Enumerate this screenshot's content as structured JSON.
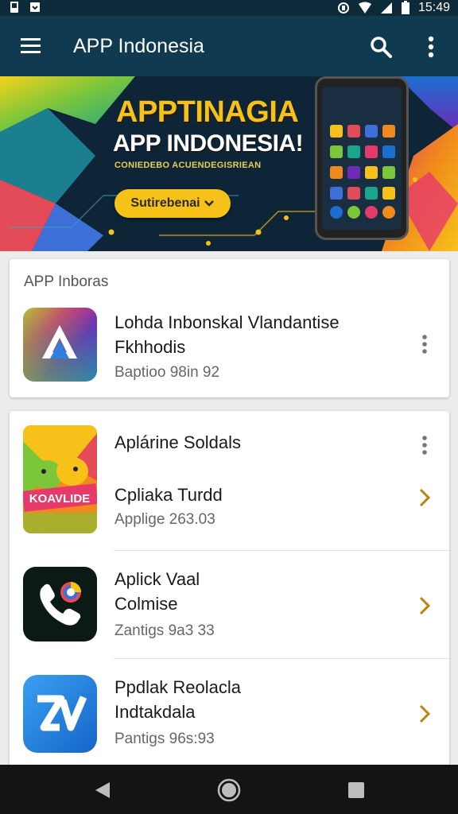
{
  "status_bar": {
    "time": "15:49"
  },
  "app_bar": {
    "title": "APP Indonesia"
  },
  "banner": {
    "headline": "APPTINAGIA",
    "subheadline": "APP INDONESIA!",
    "tagline": "CONIEDEBO ACUENDEGISRIEAN",
    "cta_label": "Sutirebenai"
  },
  "featured_section": {
    "title": "APP Inboras",
    "item": {
      "name_line1": "Lohda Inbonskal Vlandantise",
      "name_line2": "Fkhhodis",
      "meta": "Baptioo 98in 92"
    }
  },
  "list_section": {
    "items": [
      {
        "name_line1": "Aplárine Soldals",
        "subtitle": "Cpliaka Turdd",
        "meta": "Applige 263.03",
        "icon_text": "KOAVLIDE"
      },
      {
        "name_line1": "Aplick Vaal",
        "name_line2": "Colmise",
        "meta": "Zantigs 9a3 33"
      },
      {
        "name_line1": "Ppdlak Reolacla",
        "name_line2": "Indtakdala",
        "meta": "Pantigs 96s:93"
      }
    ]
  },
  "colors": {
    "app_bar": "#0f3a4f",
    "accent": "#f6c21a",
    "chevron": "#b8860b"
  },
  "icons": [
    "menu-icon",
    "search-icon",
    "more-vert-icon",
    "chevron-right-icon",
    "back-icon",
    "home-icon",
    "recents-icon"
  ]
}
